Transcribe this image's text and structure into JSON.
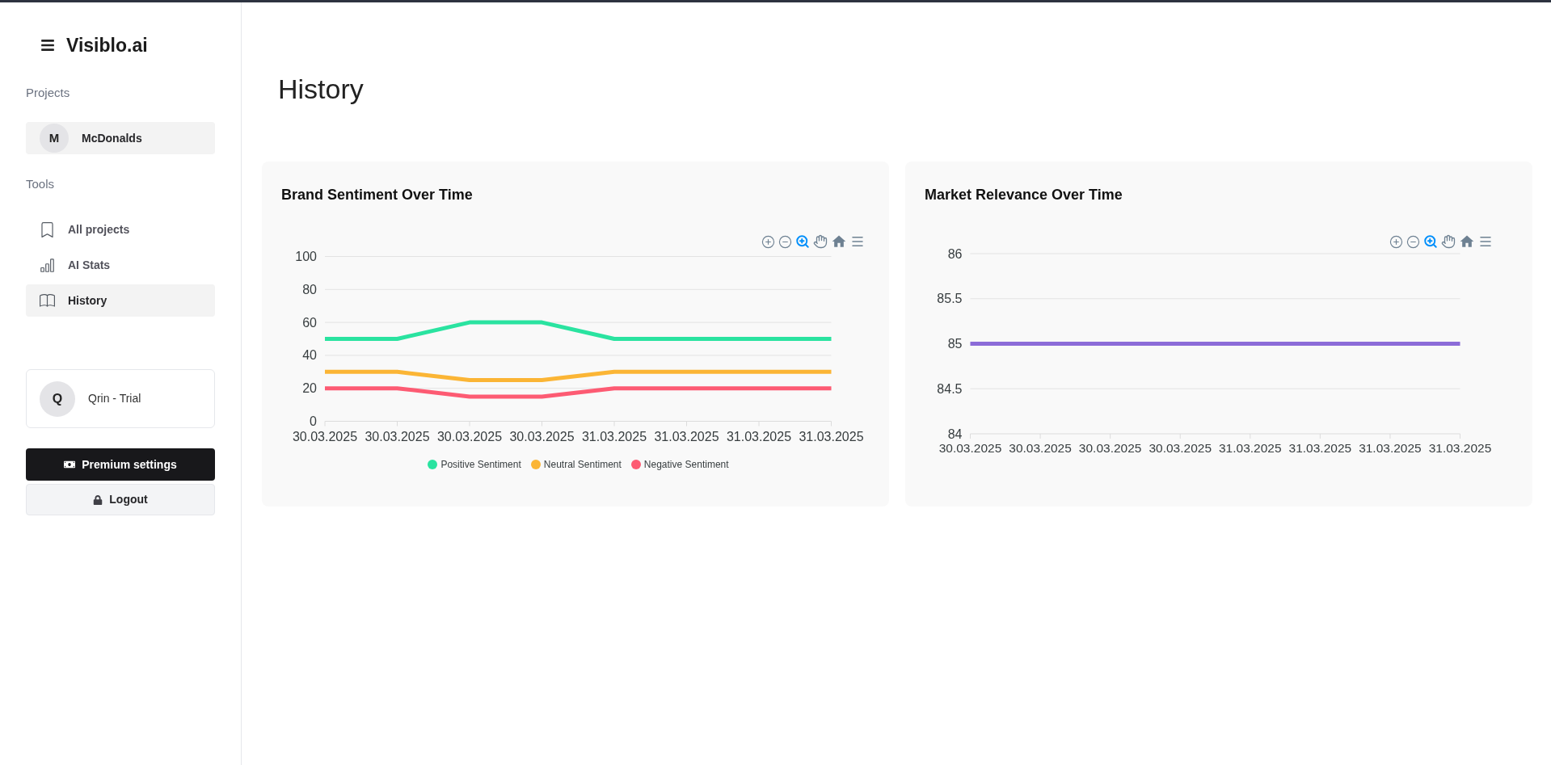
{
  "sidebar": {
    "logo": "Visiblo.ai",
    "projects_heading": "Projects",
    "projects": [
      {
        "initial": "M",
        "name": "McDonalds",
        "selected": true
      }
    ],
    "tools_heading": "Tools",
    "tools": [
      {
        "kind": "bookmark",
        "label": "All projects",
        "selected": false
      },
      {
        "kind": "bar_chart",
        "label": "AI Stats",
        "selected": false
      },
      {
        "kind": "book",
        "label": "History",
        "selected": true
      }
    ],
    "user": {
      "initial": "Q",
      "name": "Qrin - Trial"
    },
    "buttons": [
      {
        "kind": "premium",
        "label": "Premium settings"
      },
      {
        "kind": "logout",
        "label": "Logout"
      }
    ]
  },
  "page_title": "History",
  "charts": [
    {
      "toolbar": [
        {
          "kind": "zoom_in",
          "selected": false
        },
        {
          "kind": "zoom_out",
          "selected": false
        },
        {
          "kind": "zoom",
          "selected": true
        },
        {
          "kind": "pan",
          "selected": false
        },
        {
          "kind": "reset",
          "selected": false
        },
        {
          "kind": "menu",
          "selected": false
        }
      ],
      "chart_data": {
        "type": "line",
        "title": "Brand Sentiment Over Time",
        "categories": [
          "30.03.2025",
          "30.03.2025",
          "30.03.2025",
          "30.03.2025",
          "31.03.2025",
          "31.03.2025",
          "31.03.2025",
          "31.03.2025"
        ],
        "series": [
          {
            "name": "Positive Sentiment",
            "color": "#2ae3a0",
            "values": [
              50,
              50,
              60,
              60,
              50,
              50,
              50,
              50
            ]
          },
          {
            "name": "Neutral Sentiment",
            "color": "#fbb535",
            "values": [
              30,
              30,
              25,
              25,
              30,
              30,
              30,
              30
            ]
          },
          {
            "name": "Negative Sentiment",
            "color": "#fd5b73",
            "values": [
              20,
              20,
              15,
              15,
              20,
              20,
              20,
              20
            ]
          }
        ],
        "ylim": [
          0,
          100
        ],
        "yticks": [
          0,
          20,
          40,
          60,
          80,
          100
        ],
        "grid": true,
        "legend": "bottom"
      }
    },
    {
      "toolbar": [
        {
          "kind": "zoom_in",
          "selected": false
        },
        {
          "kind": "zoom_out",
          "selected": false
        },
        {
          "kind": "zoom",
          "selected": true
        },
        {
          "kind": "pan",
          "selected": false
        },
        {
          "kind": "reset",
          "selected": false
        },
        {
          "kind": "menu",
          "selected": false
        }
      ],
      "chart_data": {
        "type": "line",
        "title": "Market Relevance Over Time",
        "categories": [
          "30.03.2025",
          "30.03.2025",
          "30.03.2025",
          "30.03.2025",
          "31.03.2025",
          "31.03.2025",
          "31.03.2025",
          "31.03.2025"
        ],
        "series": [
          {
            "color": "#8c6cd8",
            "values": [
              85,
              85,
              85,
              85,
              85,
              85,
              85,
              85
            ]
          }
        ],
        "ylim": [
          84,
          86
        ],
        "yticks": [
          84,
          84.5,
          85,
          85.5,
          86
        ],
        "grid": true
      }
    }
  ]
}
